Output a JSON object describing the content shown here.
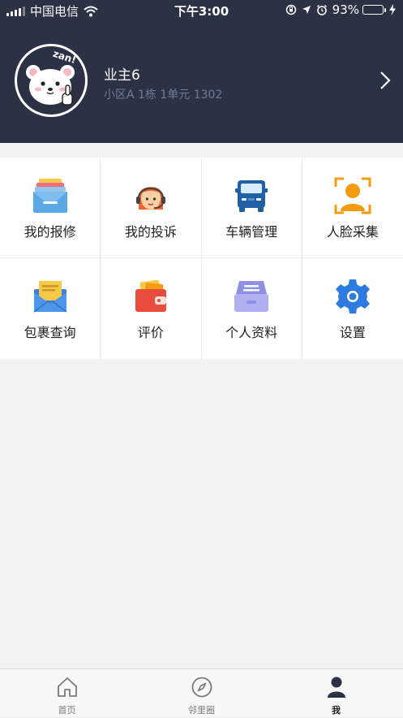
{
  "status_bar": {
    "carrier": "中国电信",
    "time": "下午3:00",
    "battery_percent": "93%",
    "battery_level": 0.93
  },
  "profile": {
    "name": "业主6",
    "address": "小区A 1栋 1单元 1302",
    "avatar_icon": "bear-zan-avatar",
    "avatar_text": "zan!"
  },
  "grid": {
    "items": [
      {
        "label": "我的报修",
        "icon": "repair-cards-icon"
      },
      {
        "label": "我的投诉",
        "icon": "complaint-agent-icon"
      },
      {
        "label": "车辆管理",
        "icon": "car-icon"
      },
      {
        "label": "人脸采集",
        "icon": "face-capture-icon"
      },
      {
        "label": "包裹查询",
        "icon": "package-envelope-icon"
      },
      {
        "label": "评价",
        "icon": "wallet-icon"
      },
      {
        "label": "个人资料",
        "icon": "archive-box-icon"
      },
      {
        "label": "设置",
        "icon": "gear-icon"
      }
    ]
  },
  "tabbar": {
    "tabs": [
      {
        "label": "首页",
        "icon": "home-icon",
        "active": false
      },
      {
        "label": "邻里圈",
        "icon": "compass-icon",
        "active": false
      },
      {
        "label": "我",
        "icon": "person-icon",
        "active": true
      }
    ]
  },
  "colors": {
    "header_bg": "#2b3245",
    "subtext": "#6f7b96",
    "page_bg": "#f2f2f2"
  }
}
